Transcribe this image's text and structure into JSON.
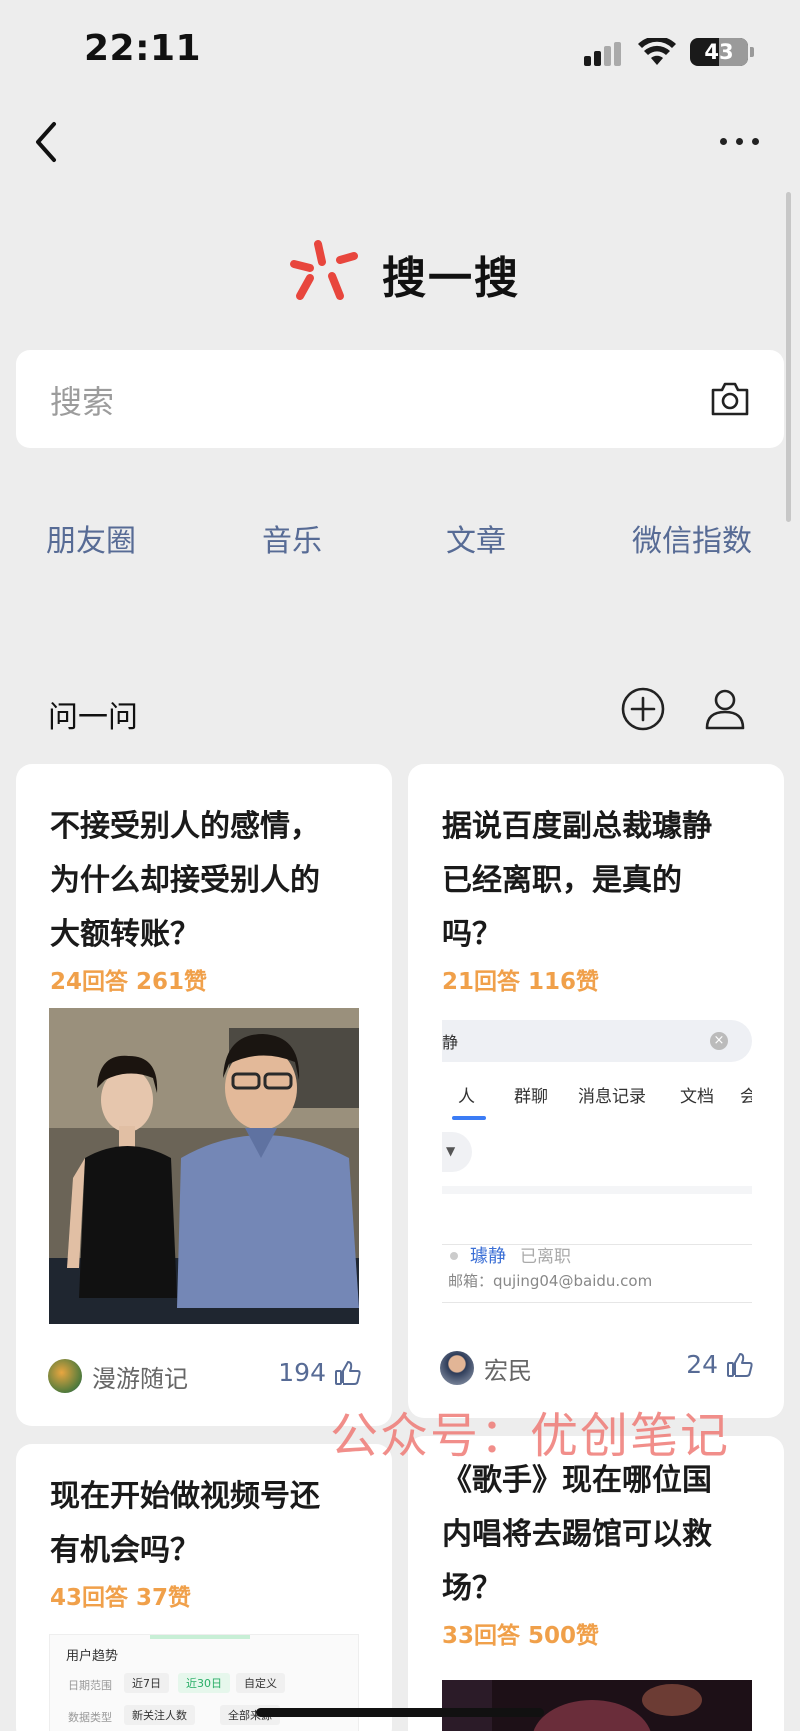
{
  "status_bar": {
    "time": "22:11",
    "battery": "43"
  },
  "header": {
    "title": "搜一搜"
  },
  "search": {
    "placeholder": "搜索"
  },
  "quick_links": [
    "朋友圈",
    "音乐",
    "文章",
    "微信指数"
  ],
  "ask": {
    "title": "问一问"
  },
  "cards": [
    {
      "title_lines": [
        "不接受别人的感情，",
        "为什么却接受别人的",
        "大额转账？"
      ],
      "stats": "24回答 261赞",
      "author": "漫游随记",
      "likes": "194"
    },
    {
      "title_lines": [
        "据说百度副总裁璩静",
        "已经离职，是真的",
        "吗？"
      ],
      "stats": "21回答 116赞",
      "author": "宏民",
      "likes": "24",
      "screenshot": {
        "search_text": "静",
        "tabs": [
          "人",
          "群聊",
          "消息记录",
          "文档",
          "会"
        ],
        "result_name": "璩静",
        "result_status": "已离职",
        "result_email": "邮箱：qujing04@baidu.com"
      }
    },
    {
      "title_lines": [
        "现在开始做视频号还",
        "有机会吗？"
      ],
      "stats": "43回答 37赞",
      "screenshot": {
        "heading": "用户趋势",
        "row1_label": "日期范围",
        "row1_options": [
          "近7日",
          "近30日",
          "自定义"
        ],
        "row2_label": "数据类型",
        "row2_options": [
          "新关注人数",
          "全部来源"
        ]
      }
    },
    {
      "title_lines": [
        "《歌手》现在哪位国",
        "内唱将去踢馆可以救",
        "场？"
      ],
      "stats": "33回答 500赞"
    }
  ],
  "watermark": "公众号：优创笔记",
  "colors": {
    "link": "#576b95",
    "stats": "#f0a04a",
    "brand_red": "#e8463d",
    "background": "#ededed"
  }
}
